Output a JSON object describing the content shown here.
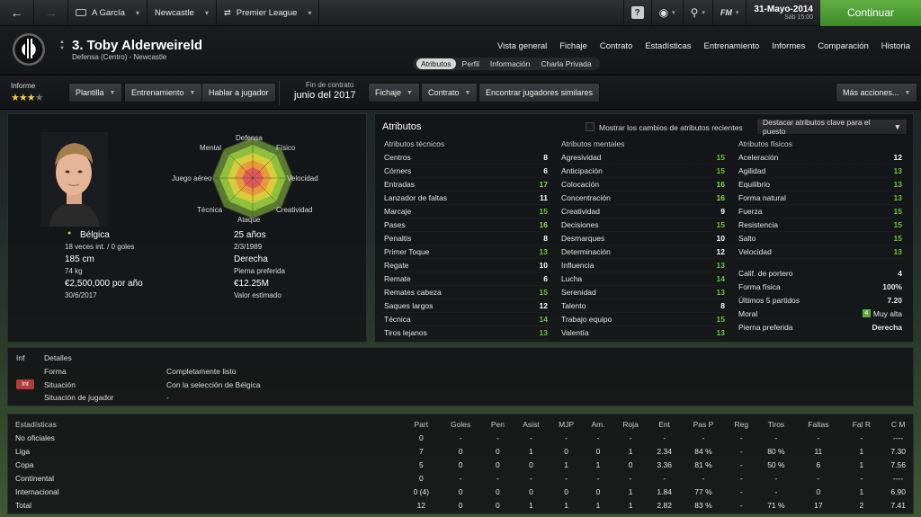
{
  "topbar": {
    "back_icon": "back-arrow-icon",
    "forward_icon": "forward-arrow-icon",
    "crumbs": [
      {
        "label": "A García"
      },
      {
        "label": "Newcastle"
      },
      {
        "label": "Premier League"
      }
    ],
    "fm_label": "FM",
    "date": "31-Mayo-2014",
    "date_sub": "Sáb 15:00",
    "continue_label": "Continuar"
  },
  "header": {
    "player_name": "3. Toby Alderweireld",
    "player_sub": "Defensa (Centro) - Newcastle",
    "main_tabs": [
      "Vista general",
      "Fichaje",
      "Contrato",
      "Estadísticas",
      "Entrenamiento",
      "Informes",
      "Comparación",
      "Historia"
    ],
    "sub_tabs": [
      "Atributos",
      "Perfil",
      "Información",
      "Charla Privada"
    ]
  },
  "toolbar": {
    "informe_label": "Informe",
    "stars_display": "★★★",
    "stars_half": "★",
    "stars_value": 3.5,
    "plantilla": "Plantilla",
    "entrenamiento": "Entrenamiento",
    "hablar": "Hablar a jugador",
    "contract_label": "Fin de contrato",
    "contract_value": "junio del 2017",
    "fichaje": "Fichaje",
    "contrato": "Contrato",
    "similares": "Encontrar jugadores similares",
    "mas_acciones": "Más acciones..."
  },
  "profile": {
    "radar_labels": {
      "defensa": "Defensa",
      "fisico": "Físico",
      "velocidad": "Velocidad",
      "creatividad": "Creatividad",
      "ataque": "Ataque",
      "tecnica": "Técnica",
      "juego_aereo": "Juego aéreo",
      "mental": "Mental"
    },
    "nation": "Bélgica",
    "caps": "18 veces int. / 0 goles",
    "height": "185 cm",
    "weight": "74 kg",
    "wage": "€2,500,000 por año",
    "contract_end": "30/6/2017",
    "age": "25 años",
    "dob": "2/3/1989",
    "foot": "Derecha",
    "foot_label": "Pierna preferida",
    "value": "€12.25M",
    "value_label": "Valor estimado"
  },
  "attributes": {
    "title": "Atributos",
    "show_changes_label": "Mostrar los cambios de atributos recientes",
    "highlight_dropdown": "Destacar atributos clave para el puesto",
    "technical": {
      "title": "Atributos técnicos",
      "rows": [
        {
          "name": "Centros",
          "value": "8"
        },
        {
          "name": "Córners",
          "value": "6"
        },
        {
          "name": "Entradas",
          "value": "17"
        },
        {
          "name": "Lanzador de faltas",
          "value": "11"
        },
        {
          "name": "Marcaje",
          "value": "15"
        },
        {
          "name": "Pases",
          "value": "16"
        },
        {
          "name": "Penaltis",
          "value": "8"
        },
        {
          "name": "Primer Toque",
          "value": "13"
        },
        {
          "name": "Regate",
          "value": "10"
        },
        {
          "name": "Remate",
          "value": "6"
        },
        {
          "name": "Remates cabeza",
          "value": "15"
        },
        {
          "name": "Saques largos",
          "value": "12"
        },
        {
          "name": "Técnica",
          "value": "14"
        },
        {
          "name": "Tiros lejanos",
          "value": "13"
        }
      ]
    },
    "mental": {
      "title": "Atributos mentales",
      "rows": [
        {
          "name": "Agresividad",
          "value": "15"
        },
        {
          "name": "Anticipación",
          "value": "15"
        },
        {
          "name": "Colocación",
          "value": "16"
        },
        {
          "name": "Concentración",
          "value": "16"
        },
        {
          "name": "Creatividad",
          "value": "9"
        },
        {
          "name": "Decisiones",
          "value": "15"
        },
        {
          "name": "Desmarques",
          "value": "10"
        },
        {
          "name": "Determinación",
          "value": "12"
        },
        {
          "name": "Influencia",
          "value": "13"
        },
        {
          "name": "Lucha",
          "value": "14"
        },
        {
          "name": "Serenidad",
          "value": "13"
        },
        {
          "name": "Talento",
          "value": "8"
        },
        {
          "name": "Trabajo equipo",
          "value": "15"
        },
        {
          "name": "Valentía",
          "value": "13"
        }
      ]
    },
    "physical": {
      "title": "Atributos físicos",
      "rows": [
        {
          "name": "Aceleración",
          "value": "12"
        },
        {
          "name": "Agilidad",
          "value": "13"
        },
        {
          "name": "Equilibrio",
          "value": "13"
        },
        {
          "name": "Forma natural",
          "value": "13"
        },
        {
          "name": "Fuerza",
          "value": "15"
        },
        {
          "name": "Resistencia",
          "value": "15"
        },
        {
          "name": "Salto",
          "value": "15"
        },
        {
          "name": "Velocidad",
          "value": "13"
        }
      ],
      "extra": [
        {
          "name": "Calif. de portero",
          "value": "4"
        },
        {
          "name": "Forma física",
          "value": "100%"
        },
        {
          "name": "Últimos 5 partidos",
          "value": "7.20"
        },
        {
          "name": "Moral",
          "value": "Muy alta",
          "badge": "4"
        },
        {
          "name": "Pierna preferida",
          "value": "Derecha"
        }
      ]
    }
  },
  "details": {
    "tab_inf": "Inf",
    "tab_detalles": "Detalles",
    "badge": "Int",
    "rows": [
      {
        "label": "Forma",
        "value": "Completamente listo"
      },
      {
        "label": "Situación",
        "value": "Con la selección de Bélgica"
      },
      {
        "label": "Situación de jugador",
        "value": "-"
      }
    ]
  },
  "stats": {
    "headers": [
      "Estadísticas",
      "Part",
      "Goles",
      "Pen",
      "Asist",
      "MJP",
      "Am.",
      "Roja",
      "Ent",
      "Pas P",
      "Reg",
      "Tiros",
      "Faltas",
      "Fal R",
      "C M"
    ],
    "rows": [
      [
        "No oficiales",
        "0",
        "-",
        "-",
        "-",
        "-",
        "-",
        "-",
        "-",
        "-",
        "-",
        "-",
        "-",
        "-",
        "----"
      ],
      [
        "Liga",
        "7",
        "0",
        "0",
        "1",
        "0",
        "0",
        "1",
        "2.34",
        "84 %",
        "-",
        "80 %",
        "11",
        "1",
        "7.30"
      ],
      [
        "Copa",
        "5",
        "0",
        "0",
        "0",
        "1",
        "1",
        "0",
        "3.36",
        "81 %",
        "-",
        "50 %",
        "6",
        "1",
        "7.56"
      ],
      [
        "Continental",
        "0",
        "-",
        "-",
        "-",
        "-",
        "-",
        "-",
        "-",
        "-",
        "-",
        "-",
        "-",
        "-",
        "----"
      ],
      [
        "Internacional",
        "0 (4)",
        "0",
        "0",
        "0",
        "0",
        "0",
        "1",
        "1.84",
        "77 %",
        "-",
        "-",
        "0",
        "1",
        "6.90"
      ],
      [
        "Total",
        "12",
        "0",
        "0",
        "1",
        "1",
        "1",
        "1",
        "2.82",
        "83 %",
        "-",
        "71 %",
        "17",
        "2",
        "7.41"
      ]
    ]
  },
  "colors": {
    "continue": "#4c9e33",
    "attr_high": "#8ed64d",
    "badge_red": "#b33b3b",
    "stars": "#f2c84b"
  }
}
